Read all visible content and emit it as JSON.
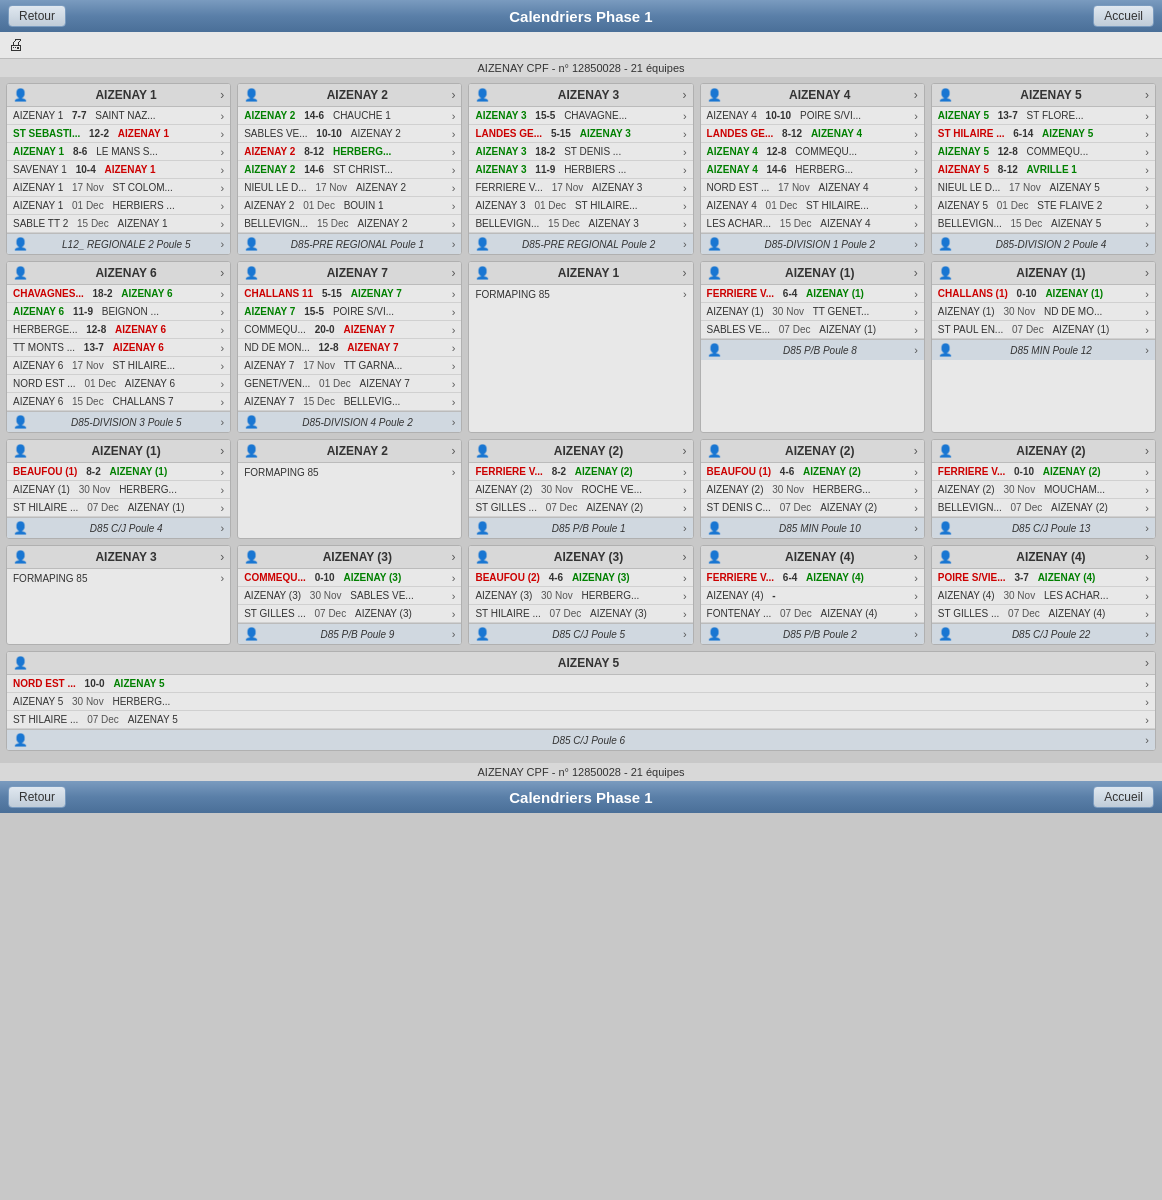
{
  "header": {
    "title": "Calendriers Phase 1",
    "retour": "Retour",
    "accueil": "Accueil",
    "subtitle": "AIZENAY CPF - n° 12850028 - 21 équipes"
  },
  "footer": {
    "title": "Calendriers Phase 1",
    "retour": "Retour",
    "accueil": "Accueil",
    "subtitle": "AIZENAY CPF - n° 12850028 - 21 équipes"
  },
  "rows": [
    [
      {
        "name": "AIZENAY 1",
        "matches": [
          {
            "home": "AIZENAY 1",
            "score": "7-7",
            "away": "SAINT NAZ...",
            "homeClass": "",
            "awayClass": "",
            "scoreClass": ""
          },
          {
            "home": "ST SEBASTI...",
            "score": "12-2",
            "away": "AIZENAY 1",
            "homeClass": "team-green",
            "awayClass": "team-red",
            "scoreClass": ""
          },
          {
            "home": "AIZENAY 1",
            "score": "8-6",
            "away": "LE MANS S...",
            "homeClass": "team-green",
            "awayClass": "",
            "scoreClass": ""
          },
          {
            "home": "SAVENAY 1",
            "score": "10-4",
            "away": "AIZENAY 1",
            "homeClass": "",
            "awayClass": "team-red",
            "scoreClass": ""
          },
          {
            "home": "AIZENAY 1",
            "date": "17 Nov",
            "away": "ST COLOM...",
            "dateRow": true
          },
          {
            "home": "AIZENAY 1",
            "date": "01 Dec",
            "away": "HERBIERS ...",
            "dateRow": true
          },
          {
            "home": "SABLE TT 2",
            "date": "15 Dec",
            "away": "AIZENAY 1",
            "dateRow": true
          }
        ],
        "poule": "L12_ REGIONALE 2 Poule 5"
      },
      {
        "name": "AIZENAY 2",
        "matches": [
          {
            "home": "AIZENAY 2",
            "score": "14-6",
            "away": "CHAUCHE 1",
            "homeClass": "team-green",
            "awayClass": "",
            "scoreClass": ""
          },
          {
            "home": "SABLES VE...",
            "score": "10-10",
            "away": "AIZENAY 2",
            "homeClass": "",
            "awayClass": "",
            "scoreClass": ""
          },
          {
            "home": "AIZENAY 2",
            "score": "8-12",
            "away": "HERBERG...",
            "homeClass": "team-red",
            "awayClass": "team-green",
            "scoreClass": ""
          },
          {
            "home": "AIZENAY 2",
            "score": "14-6",
            "away": "ST CHRIST...",
            "homeClass": "team-green",
            "awayClass": "",
            "scoreClass": ""
          },
          {
            "home": "NIEUL LE D...",
            "date": "17 Nov",
            "away": "AIZENAY 2",
            "dateRow": true
          },
          {
            "home": "AIZENAY 2",
            "date": "01 Dec",
            "away": "BOUIN 1",
            "dateRow": true
          },
          {
            "home": "BELLEVIGN...",
            "date": "15 Dec",
            "away": "AIZENAY 2",
            "dateRow": true
          }
        ],
        "poule": "D85-PRE REGIONAL Poule 1"
      },
      {
        "name": "AIZENAY 3",
        "matches": [
          {
            "home": "AIZENAY 3",
            "score": "15-5",
            "away": "CHAVAGNE...",
            "homeClass": "team-green",
            "awayClass": "",
            "scoreClass": ""
          },
          {
            "home": "LANDES GE...",
            "score": "5-15",
            "away": "AIZENAY 3",
            "homeClass": "team-red",
            "awayClass": "team-green",
            "scoreClass": ""
          },
          {
            "home": "AIZENAY 3",
            "score": "18-2",
            "away": "ST DENIS ...",
            "homeClass": "team-green",
            "awayClass": "",
            "scoreClass": ""
          },
          {
            "home": "AIZENAY 3",
            "score": "11-9",
            "away": "HERBIERS ...",
            "homeClass": "team-green",
            "awayClass": "",
            "scoreClass": ""
          },
          {
            "home": "FERRIERE V...",
            "date": "17 Nov",
            "away": "AIZENAY 3",
            "dateRow": true
          },
          {
            "home": "AIZENAY 3",
            "date": "01 Dec",
            "away": "ST HILAIRE...",
            "dateRow": true
          },
          {
            "home": "BELLEVIGN...",
            "date": "15 Dec",
            "away": "AIZENAY 3",
            "dateRow": true
          }
        ],
        "poule": "D85-PRE REGIONAL Poule 2"
      },
      {
        "name": "AIZENAY 4",
        "matches": [
          {
            "home": "AIZENAY 4",
            "score": "10-10",
            "away": "POIRE S/VI...",
            "homeClass": "",
            "awayClass": "",
            "scoreClass": ""
          },
          {
            "home": "LANDES GE...",
            "score": "8-12",
            "away": "AIZENAY 4",
            "homeClass": "team-red",
            "awayClass": "team-green",
            "scoreClass": ""
          },
          {
            "home": "AIZENAY 4",
            "score": "12-8",
            "away": "COMMEQU...",
            "homeClass": "team-green",
            "awayClass": "",
            "scoreClass": ""
          },
          {
            "home": "AIZENAY 4",
            "score": "14-6",
            "away": "HERBERG...",
            "homeClass": "team-green",
            "awayClass": "",
            "scoreClass": ""
          },
          {
            "home": "NORD EST ...",
            "date": "17 Nov",
            "away": "AIZENAY 4",
            "dateRow": true
          },
          {
            "home": "AIZENAY 4",
            "date": "01 Dec",
            "away": "ST HILAIRE...",
            "dateRow": true
          },
          {
            "home": "LES ACHAR...",
            "date": "15 Dec",
            "away": "AIZENAY 4",
            "dateRow": true
          }
        ],
        "poule": "D85-DIVISION 1 Poule 2"
      },
      {
        "name": "AIZENAY 5",
        "matches": [
          {
            "home": "AIZENAY 5",
            "score": "13-7",
            "away": "ST FLORE...",
            "homeClass": "team-green",
            "awayClass": "",
            "scoreClass": ""
          },
          {
            "home": "ST HILAIRE ...",
            "score": "6-14",
            "away": "AIZENAY 5",
            "homeClass": "team-red",
            "awayClass": "team-green",
            "scoreClass": ""
          },
          {
            "home": "AIZENAY 5",
            "score": "12-8",
            "away": "COMMEQU...",
            "homeClass": "team-green",
            "awayClass": "",
            "scoreClass": ""
          },
          {
            "home": "AIZENAY 5",
            "score": "8-12",
            "away": "AVRILLE 1",
            "homeClass": "team-red",
            "awayClass": "team-green",
            "scoreClass": ""
          },
          {
            "home": "NIEUL LE D...",
            "date": "17 Nov",
            "away": "AIZENAY 5",
            "dateRow": true
          },
          {
            "home": "AIZENAY 5",
            "date": "01 Dec",
            "away": "STE FLAIVE 2",
            "dateRow": true
          },
          {
            "home": "BELLEVIGN...",
            "date": "15 Dec",
            "away": "AIZENAY 5",
            "dateRow": true
          }
        ],
        "poule": "D85-DIVISION 2 Poule 4"
      }
    ],
    [
      {
        "name": "AIZENAY 6",
        "matches": [
          {
            "home": "CHAVAGNES...",
            "score": "18-2",
            "away": "AIZENAY 6",
            "homeClass": "team-red",
            "awayClass": "team-green",
            "scoreClass": ""
          },
          {
            "home": "AIZENAY 6",
            "score": "11-9",
            "away": "BEIGNON ...",
            "homeClass": "team-green",
            "awayClass": "",
            "scoreClass": ""
          },
          {
            "home": "HERBERGE...",
            "score": "12-8",
            "away": "AIZENAY 6",
            "homeClass": "",
            "awayClass": "team-red",
            "scoreClass": ""
          },
          {
            "home": "TT MONTS ...",
            "score": "13-7",
            "away": "AIZENAY 6",
            "homeClass": "",
            "awayClass": "team-red",
            "scoreClass": ""
          },
          {
            "home": "AIZENAY 6",
            "date": "17 Nov",
            "away": "ST HILAIRE...",
            "dateRow": true
          },
          {
            "home": "NORD EST ...",
            "date": "01 Dec",
            "away": "AIZENAY 6",
            "dateRow": true
          },
          {
            "home": "AIZENAY 6",
            "date": "15 Dec",
            "away": "CHALLANS 7",
            "dateRow": true
          }
        ],
        "poule": "D85-DIVISION 3 Poule 5"
      },
      {
        "name": "AIZENAY 7",
        "matches": [
          {
            "home": "CHALLANS 11",
            "score": "5-15",
            "away": "AIZENAY 7",
            "homeClass": "team-red",
            "awayClass": "team-green",
            "scoreClass": ""
          },
          {
            "home": "AIZENAY 7",
            "score": "15-5",
            "away": "POIRE S/VI...",
            "homeClass": "team-green",
            "awayClass": "",
            "scoreClass": ""
          },
          {
            "home": "COMMEQU...",
            "score": "20-0",
            "away": "AIZENAY 7",
            "homeClass": "",
            "awayClass": "team-red",
            "scoreClass": ""
          },
          {
            "home": "ND DE MON...",
            "score": "12-8",
            "away": "AIZENAY 7",
            "homeClass": "",
            "awayClass": "team-red",
            "scoreClass": ""
          },
          {
            "home": "AIZENAY 7",
            "date": "17 Nov",
            "away": "TT GARNA...",
            "dateRow": true
          },
          {
            "home": "GENET/VEN...",
            "date": "01 Dec",
            "away": "AIZENAY 7",
            "dateRow": true
          },
          {
            "home": "AIZENAY 7",
            "date": "15 Dec",
            "away": "BELLEVIG...",
            "dateRow": true
          }
        ],
        "poule": "D85-DIVISION 4 Poule 2"
      },
      {
        "name": "AIZENAY 1",
        "matches": [
          {
            "home": "FORMAPING 85",
            "score": "",
            "away": "",
            "homeClass": "",
            "awayClass": "",
            "scoreClass": "",
            "single": true
          }
        ],
        "poule": null
      },
      {
        "name": "AIZENAY (1)",
        "matches": [
          {
            "home": "FERRIERE V...",
            "score": "6-4",
            "away": "AIZENAY (1)",
            "homeClass": "team-red",
            "awayClass": "team-green",
            "scoreClass": ""
          },
          {
            "home": "AIZENAY (1)",
            "date": "30 Nov",
            "away": "TT GENET...",
            "dateRow": true
          },
          {
            "home": "SABLES VE...",
            "date": "07 Dec",
            "away": "AIZENAY (1)",
            "dateRow": true
          }
        ],
        "poule": "D85 P/B Poule 8"
      },
      {
        "name": "AIZENAY (1)",
        "matches": [
          {
            "home": "CHALLANS (1)",
            "score": "0-10",
            "away": "AIZENAY (1)",
            "homeClass": "team-red",
            "awayClass": "team-green",
            "scoreClass": ""
          },
          {
            "home": "AIZENAY (1)",
            "date": "30 Nov",
            "away": "ND DE MO...",
            "dateRow": true
          },
          {
            "home": "ST PAUL EN...",
            "date": "07 Dec",
            "away": "AIZENAY (1)",
            "dateRow": true
          }
        ],
        "poule": "D85 MIN Poule 12"
      }
    ],
    [
      {
        "name": "AIZENAY (1)",
        "matches": [
          {
            "home": "BEAUFOU (1)",
            "score": "8-2",
            "away": "AIZENAY (1)",
            "homeClass": "team-red",
            "awayClass": "team-green",
            "scoreClass": ""
          },
          {
            "home": "AIZENAY (1)",
            "date": "30 Nov",
            "away": "HERBERG...",
            "dateRow": true
          },
          {
            "home": "ST HILAIRE ...",
            "date": "07 Dec",
            "away": "AIZENAY (1)",
            "dateRow": true
          }
        ],
        "poule": "D85 C/J Poule 4"
      },
      {
        "name": "AIZENAY 2",
        "matches": [
          {
            "home": "FORMAPING 85",
            "score": "",
            "away": "",
            "homeClass": "",
            "awayClass": "",
            "scoreClass": "",
            "single": true
          }
        ],
        "poule": null
      },
      {
        "name": "AIZENAY (2)",
        "matches": [
          {
            "home": "FERRIERE V...",
            "score": "8-2",
            "away": "AIZENAY (2)",
            "homeClass": "team-red",
            "awayClass": "team-green",
            "scoreClass": ""
          },
          {
            "home": "AIZENAY (2)",
            "date": "30 Nov",
            "away": "ROCHE VE...",
            "dateRow": true
          },
          {
            "home": "ST GILLES ...",
            "date": "07 Dec",
            "away": "AIZENAY (2)",
            "dateRow": true
          }
        ],
        "poule": "D85 P/B Poule 1"
      },
      {
        "name": "AIZENAY (2)",
        "matches": [
          {
            "home": "BEAUFOU (1)",
            "score": "4-6",
            "away": "AIZENAY (2)",
            "homeClass": "team-red",
            "awayClass": "team-green",
            "scoreClass": ""
          },
          {
            "home": "AIZENAY (2)",
            "date": "30 Nov",
            "away": "HERBERG...",
            "dateRow": true
          },
          {
            "home": "ST DENIS C...",
            "date": "07 Dec",
            "away": "AIZENAY (2)",
            "dateRow": true
          }
        ],
        "poule": "D85 MIN Poule 10"
      },
      {
        "name": "AIZENAY (2)",
        "matches": [
          {
            "home": "FERRIERE V...",
            "score": "0-10",
            "away": "AIZENAY (2)",
            "homeClass": "team-red",
            "awayClass": "team-green",
            "scoreClass": ""
          },
          {
            "home": "AIZENAY (2)",
            "date": "30 Nov",
            "away": "MOUCHAM...",
            "dateRow": true
          },
          {
            "home": "BELLEVIGN...",
            "date": "07 Dec",
            "away": "AIZENAY (2)",
            "dateRow": true
          }
        ],
        "poule": "D85 C/J Poule 13"
      }
    ],
    [
      {
        "name": "AIZENAY 3",
        "matches": [
          {
            "home": "FORMAPING 85",
            "score": "",
            "away": "",
            "homeClass": "",
            "awayClass": "",
            "scoreClass": "",
            "single": true
          }
        ],
        "poule": null
      },
      {
        "name": "AIZENAY (3)",
        "matches": [
          {
            "home": "COMMEQU...",
            "score": "0-10",
            "away": "AIZENAY (3)",
            "homeClass": "team-red",
            "awayClass": "team-green",
            "scoreClass": ""
          },
          {
            "home": "AIZENAY (3)",
            "date": "30 Nov",
            "away": "SABLES VE...",
            "dateRow": true
          },
          {
            "home": "ST GILLES ...",
            "date": "07 Dec",
            "away": "AIZENAY (3)",
            "dateRow": true
          }
        ],
        "poule": "D85 P/B Poule 9"
      },
      {
        "name": "AIZENAY (3)",
        "matches": [
          {
            "home": "BEAUFOU (2)",
            "score": "4-6",
            "away": "AIZENAY (3)",
            "homeClass": "team-red",
            "awayClass": "team-green",
            "scoreClass": ""
          },
          {
            "home": "AIZENAY (3)",
            "date": "30 Nov",
            "away": "HERBERG...",
            "dateRow": true
          },
          {
            "home": "ST HILAIRE ...",
            "date": "07 Dec",
            "away": "AIZENAY (3)",
            "dateRow": true
          }
        ],
        "poule": "D85 C/J Poule 5"
      },
      {
        "name": "AIZENAY (4)",
        "matches": [
          {
            "home": "FERRIERE V...",
            "score": "6-4",
            "away": "AIZENAY (4)",
            "homeClass": "team-red",
            "awayClass": "team-green",
            "scoreClass": ""
          },
          {
            "home": "AIZENAY (4)",
            "score": "-",
            "away": "",
            "homeClass": "",
            "awayClass": "",
            "scoreClass": "",
            "dashRow": true
          },
          {
            "home": "FONTENAY ...",
            "date": "07 Dec",
            "away": "AIZENAY (4)",
            "dateRow": true
          }
        ],
        "poule": "D85 P/B Poule 2"
      },
      {
        "name": "AIZENAY (4)",
        "matches": [
          {
            "home": "POIRE S/VIE...",
            "score": "3-7",
            "away": "AIZENAY (4)",
            "homeClass": "team-red",
            "awayClass": "team-green",
            "scoreClass": ""
          },
          {
            "home": "AIZENAY (4)",
            "date": "30 Nov",
            "away": "LES ACHAR...",
            "dateRow": true
          },
          {
            "home": "ST GILLES ...",
            "date": "07 Dec",
            "away": "AIZENAY (4)",
            "dateRow": true
          }
        ],
        "poule": "D85 C/J Poule 22"
      }
    ],
    [
      {
        "name": "AIZENAY 5",
        "matches": [
          {
            "home": "NORD EST ...",
            "score": "10-0",
            "away": "AIZENAY 5",
            "homeClass": "team-red",
            "awayClass": "team-green",
            "scoreClass": ""
          },
          {
            "home": "AIZENAY 5",
            "date": "30 Nov",
            "away": "HERBERG...",
            "dateRow": true
          },
          {
            "home": "ST HILAIRE ...",
            "date": "07 Dec",
            "away": "AIZENAY 5",
            "dateRow": true
          }
        ],
        "poule": "D85 C/J Poule 6"
      }
    ]
  ]
}
